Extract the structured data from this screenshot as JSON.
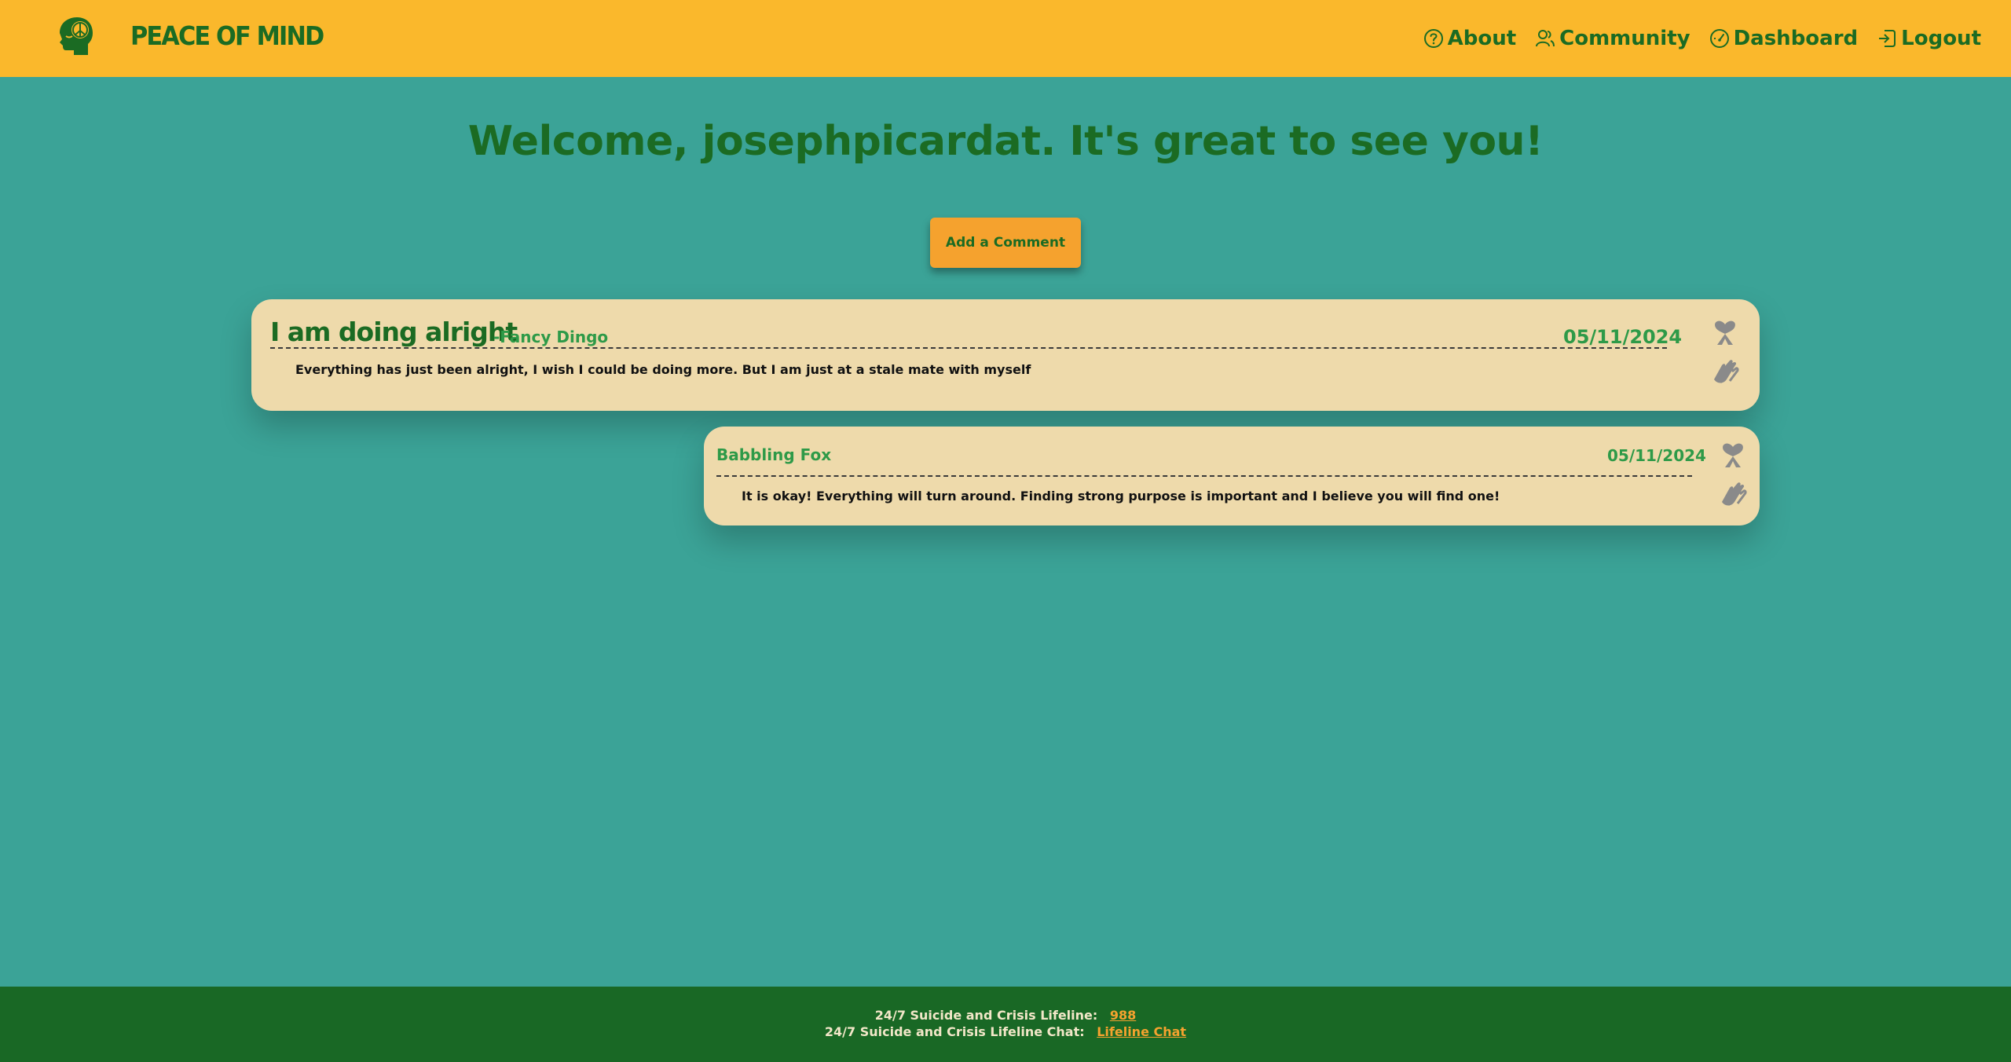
{
  "header": {
    "brand": "PEACE OF MIND",
    "nav": [
      {
        "label": "About",
        "icon": "question-circle-icon"
      },
      {
        "label": "Community",
        "icon": "people-icon"
      },
      {
        "label": "Dashboard",
        "icon": "gauge-icon"
      },
      {
        "label": "Logout",
        "icon": "logout-icon"
      }
    ]
  },
  "main": {
    "welcome": "Welcome, josephpicardat. It's great to see you!",
    "add_comment_label": "Add a Comment",
    "post": {
      "title": "I am doing alright",
      "author": "-Fancy Dingo",
      "date": "05/11/2024",
      "body": "Everything has just been alright, I wish I could be doing more. But I am just at a stale mate with myself"
    },
    "reply": {
      "author": "Babbling Fox",
      "date": "05/11/2024",
      "body": "It is okay! Everything will turn around. Finding strong purpose is important and I believe you will find one!"
    }
  },
  "footer": {
    "lifeline_label": "24/7 Suicide and Crisis Lifeline:",
    "lifeline_number": "988",
    "chat_label": "24/7 Suicide and Crisis Lifeline Chat:",
    "chat_link": "Lifeline Chat"
  },
  "colors": {
    "header_bg": "#fab82c",
    "page_bg": "#3ba397",
    "card_bg": "#eedaab",
    "brand_green": "#1b6b23",
    "accent_orange": "#f5a22e",
    "footer_bg": "#196825"
  }
}
